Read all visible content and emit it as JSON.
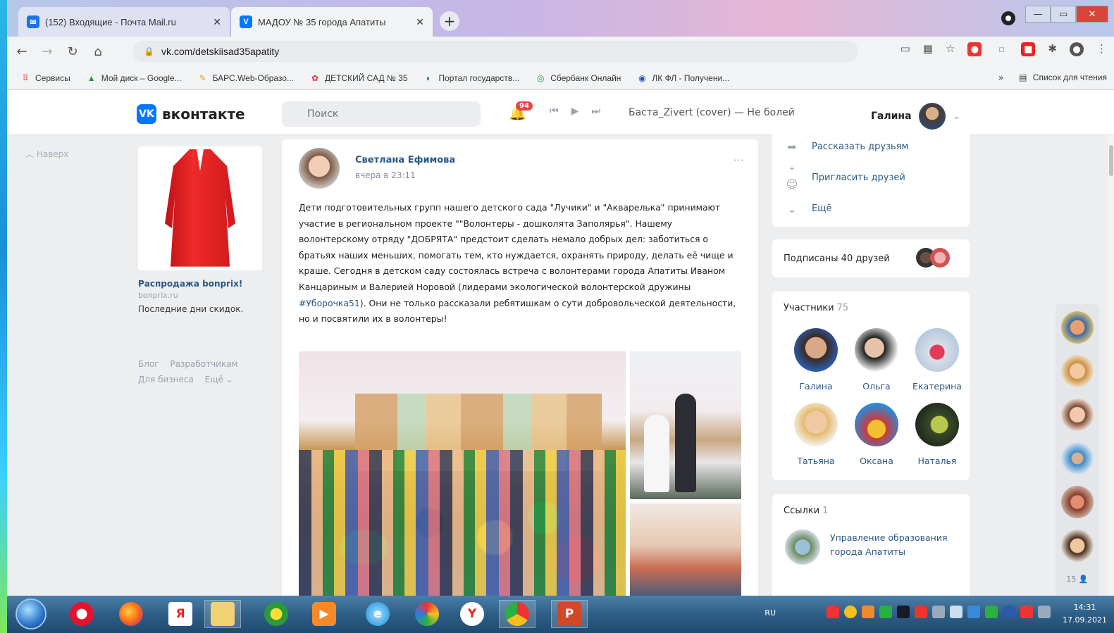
{
  "browser": {
    "tabs": [
      {
        "label": "(152) Входящие - Почта Mail.ru",
        "favicon": "mail-icon",
        "active": false
      },
      {
        "label": "МАДОУ № 35 города Апатиты",
        "favicon": "vk-icon",
        "active": true
      }
    ],
    "url": "vk.com/detskiisad35apatity",
    "bookmarks": [
      {
        "label": "Сервисы",
        "icon": "apps-grid-icon"
      },
      {
        "label": "Мой диск – Google...",
        "icon": "google-drive-icon"
      },
      {
        "label": "БАРС.Web-Образо...",
        "icon": "bars-icon"
      },
      {
        "label": "ДЕТСКИЙ САД № 35",
        "icon": "kindergarten-icon"
      },
      {
        "label": "Портал государств...",
        "icon": "gosuslugi-icon"
      },
      {
        "label": "Сбербанк Онлайн",
        "icon": "sberbank-icon"
      },
      {
        "label": "ЛК ФЛ - Получени...",
        "icon": "nalog-icon"
      }
    ],
    "bookmarks_more": "»",
    "reading_list": "Список для чтения"
  },
  "vk_header": {
    "logo_text": "вконтакте",
    "search_placeholder": "Поиск",
    "notifications_count": "94",
    "track": "Баста_Zivert (cover) — Не болей",
    "user_name": "Галина"
  },
  "left_column": {
    "back_to_top": "Наверх",
    "ad": {
      "title": "Распродажа bonprix!",
      "domain": "bonprix.ru",
      "description": "Последние дни скидок."
    },
    "footer_links": [
      "Блог",
      "Разработчикам",
      "Для бизнеса",
      "Ещё ⌄"
    ]
  },
  "post": {
    "author": "Светлана Ефимова",
    "time": "вчера в 23:11",
    "more": "···",
    "text_before_tag": "Дети подготовительных групп нашего детского сада \"Лучики\" и \"Акварелька\" принимают участие в региональном проекте \"\"Волонтеры - дошколята Заполярья\". Нашему волонтерскому отряду \"ДОБРЯТА\" предстоит сделать немало добрых дел: заботиться о братьях наших меньших, помогать тем, кто нуждается, охранять природу, делать её чище и краше. Сегодня в детском саду состоялась встреча с волонтерами города Апатиты Иваном Канцариным и Валерией Норовой (лидерами экологической волонтерской дружины ",
    "hashtag": "#Уборочка51",
    "text_after_tag": "). Они не только рассказали ребятишкам о сути добровольческой деятельности, но и посвятили их в волонтеры!"
  },
  "right_column": {
    "actions": [
      {
        "label": "Рассказать друзьям",
        "icon": "share-icon"
      },
      {
        "label": "Пригласить друзей",
        "icon": "invite-icon"
      },
      {
        "label": "Ещё",
        "icon": "chevron-down-icon"
      }
    ],
    "subscribed_friends": "Подписаны 40 друзей",
    "members": {
      "title": "Участники",
      "count": "75",
      "people": [
        "Галина",
        "Ольга",
        "Екатерина",
        "Татьяна",
        "Оксана",
        "Наталья"
      ]
    },
    "links": {
      "title": "Ссылки",
      "count": "1",
      "items": [
        "Управление образования города Апатиты"
      ]
    }
  },
  "online_friends": {
    "count": "15 👤"
  },
  "taskbar": {
    "language": "RU",
    "time": "14:31",
    "date": "17.09.2021"
  }
}
